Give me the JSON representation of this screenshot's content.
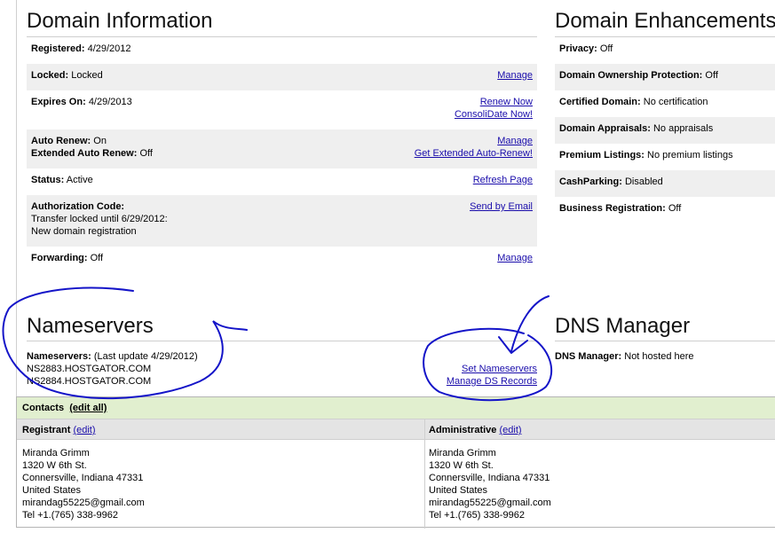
{
  "domain_info": {
    "title": "Domain Information",
    "registered": {
      "label": "Registered:",
      "value": "4/29/2012"
    },
    "locked": {
      "label": "Locked:",
      "value": "Locked",
      "link": "Manage"
    },
    "expires": {
      "label": "Expires On:",
      "value": "4/29/2013",
      "link1": "Renew Now",
      "link2": "ConsoliDate Now!"
    },
    "auto_renew": {
      "label": "Auto Renew:",
      "value": "On",
      "label2": "Extended Auto Renew:",
      "value2": "Off",
      "link1": "Manage",
      "link2": "Get Extended Auto-Renew!"
    },
    "status": {
      "label": "Status:",
      "value": "Active",
      "link": "Refresh Page"
    },
    "auth": {
      "label": "Authorization Code:",
      "line1": "Transfer locked until 6/29/2012:",
      "line2": "New domain registration",
      "link": "Send by Email"
    },
    "forwarding": {
      "label": "Forwarding:",
      "value": "Off",
      "link": "Manage"
    }
  },
  "enhancements": {
    "title": "Domain Enhancements",
    "items": [
      {
        "label": "Privacy:",
        "value": "Off"
      },
      {
        "label": "Domain Ownership Protection:",
        "value": "Off"
      },
      {
        "label": "Certified Domain:",
        "value": "No certification"
      },
      {
        "label": "Domain Appraisals:",
        "value": "No appraisals"
      },
      {
        "label": "Premium Listings:",
        "value": "No premium listings"
      },
      {
        "label": "CashParking:",
        "value": "Disabled"
      },
      {
        "label": "Business Registration:",
        "value": "Off"
      }
    ]
  },
  "nameservers": {
    "title": "Nameservers",
    "label": "Nameservers:",
    "updated": "(Last update 4/29/2012)",
    "ns1": "NS2883.HOSTGATOR.COM",
    "ns2": "NS2884.HOSTGATOR.COM",
    "link1": "Set Nameservers",
    "link2": "Manage DS Records"
  },
  "dns": {
    "title": "DNS Manager",
    "label": "DNS Manager:",
    "value": "Not hosted here"
  },
  "contacts": {
    "title": "Contacts",
    "edit_all": "(edit all)",
    "registrant": {
      "heading": "Registrant",
      "edit": "(edit)",
      "name": "Miranda Grimm",
      "street": "1320 W 6th St.",
      "city": "Connersville, Indiana 47331",
      "country": "United States",
      "email": "mirandag55225@gmail.com",
      "tel": "Tel +1.(765) 338-9962"
    },
    "administrative": {
      "heading": "Administrative",
      "edit": "(edit)",
      "name": "Miranda Grimm",
      "street": "1320 W 6th St.",
      "city": "Connersville, Indiana 47331",
      "country": "United States",
      "email": "mirandag55225@gmail.com",
      "tel": "Tel +1.(765) 338-9962"
    }
  },
  "colors": {
    "ink": "#1414c8",
    "link": "#1a0dab",
    "contacts_header": "#e1efcf"
  }
}
